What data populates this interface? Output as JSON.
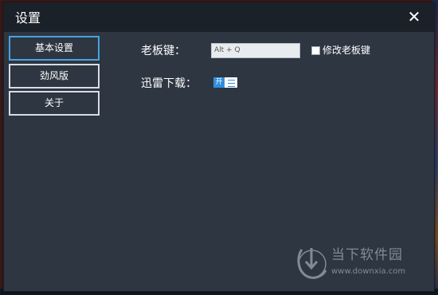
{
  "window": {
    "title": "设置",
    "close_glyph": "✕"
  },
  "nav": {
    "items": [
      {
        "label": "基本设置",
        "active": true
      },
      {
        "label": "劲风版",
        "active": false
      },
      {
        "label": "关于",
        "active": false
      }
    ]
  },
  "settings": {
    "boss_key_label": "老板键：",
    "boss_key_value": "Alt + Q",
    "modify_boss_key_label": "修改老板键",
    "modify_boss_key_checked": false,
    "xunlei_label": "迅雷下载：",
    "xunlei_toggle_text": "开",
    "xunlei_toggle_on": true
  },
  "watermark": {
    "brand": "当下软件园",
    "url": "www.downxia.com"
  },
  "colors": {
    "window_bg": "#2d3641",
    "titlebar_bg": "#1b2129",
    "active_border": "#4aa3df",
    "toggle_on": "#2e8ee0"
  }
}
